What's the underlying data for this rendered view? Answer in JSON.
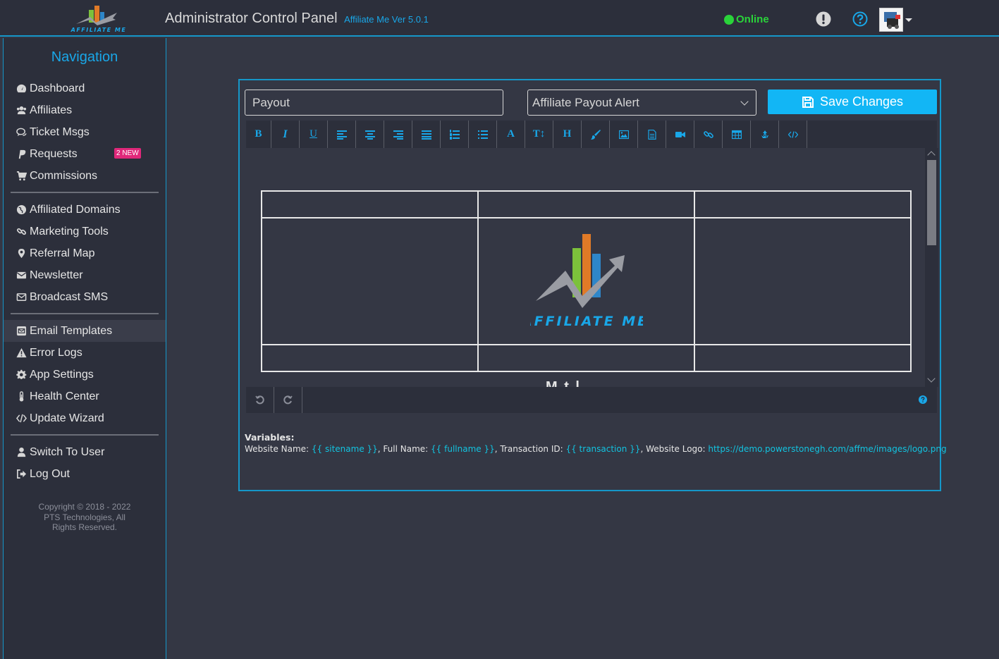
{
  "header": {
    "title": "Administrator Control Panel",
    "version": "Affiliate Me Ver 5.0.1",
    "status": "Online",
    "logo_text": "AFFILIATE ME"
  },
  "sidebar": {
    "title": "Navigation",
    "group1": [
      {
        "label": "Dashboard",
        "icon": "dashboard-icon"
      },
      {
        "label": "Affiliates",
        "icon": "users-icon"
      },
      {
        "label": "Ticket Msgs",
        "icon": "comments-icon"
      },
      {
        "label": "Requests",
        "icon": "paypal-icon",
        "badge": "2 NEW"
      },
      {
        "label": "Commissions",
        "icon": "cart-icon"
      }
    ],
    "group2": [
      {
        "label": "Affiliated Domains",
        "icon": "globe-icon"
      },
      {
        "label": "Marketing Tools",
        "icon": "link-icon"
      },
      {
        "label": "Referral Map",
        "icon": "map-marker-icon"
      },
      {
        "label": "Newsletter",
        "icon": "envelope-icon"
      },
      {
        "label": "Broadcast SMS",
        "icon": "envelope-outline-icon"
      }
    ],
    "group3": [
      {
        "label": "Email Templates",
        "icon": "envelope-square-icon"
      },
      {
        "label": "Error Logs",
        "icon": "warning-icon"
      },
      {
        "label": "App Settings",
        "icon": "gear-icon"
      },
      {
        "label": "Health Center",
        "icon": "thermometer-icon"
      },
      {
        "label": "Update Wizard",
        "icon": "code-icon"
      }
    ],
    "group4": [
      {
        "label": "Switch To User",
        "icon": "user-icon"
      },
      {
        "label": "Log Out",
        "icon": "sign-out-icon"
      }
    ],
    "copyright": "Copyright © 2018 - 2022 PTS Technologies, All Rights Reserved."
  },
  "form": {
    "subject_value": "Payout",
    "template_selected": "Affiliate Payout Alert",
    "save_label": "Save Changes"
  },
  "editor": {
    "logo_text": "AFFILIATE ME",
    "peek_text": "M   t  l"
  },
  "variables": {
    "title": "Variables:",
    "website_name_label": "Website Name: ",
    "website_name_var": "{{ sitename }}",
    "full_name_label": ", Full Name: ",
    "full_name_var": "{{ fullname }}",
    "transaction_label": ", Transaction ID: ",
    "transaction_var": "{{ transaction }}",
    "logo_label": ", Website Logo: ",
    "logo_var": "https://demo.powerstonegh.com/affme/images/logo.png"
  }
}
